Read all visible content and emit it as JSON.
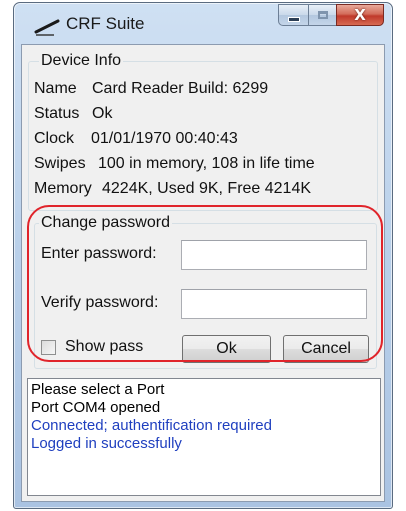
{
  "window": {
    "title": "CRF Suite",
    "controls": {
      "minimize": "minimize",
      "maximize": "maximize",
      "close_glyph": "X"
    }
  },
  "device_info": {
    "title": "Device Info",
    "rows": [
      {
        "key": "Name",
        "value": "Card Reader Build: 6299"
      },
      {
        "key": "Status",
        "value": "Ok"
      },
      {
        "key": "Clock",
        "value": "01/01/1970 00:40:43"
      },
      {
        "key": "Swipes",
        "value": "100 in memory, 108 in life time"
      },
      {
        "key": "Memory",
        "value": "4224K, Used 9K, Free 4214K"
      }
    ]
  },
  "change_password": {
    "title": "Change password",
    "enter_label": "Enter password:",
    "enter_value": "",
    "verify_label": "Verify password:",
    "verify_value": "",
    "show_pass_label": "Show pass",
    "show_pass_checked": false,
    "ok_label": "Ok",
    "cancel_label": "Cancel"
  },
  "log": {
    "lines": [
      {
        "text": "Please select a Port",
        "color": "#000000"
      },
      {
        "text": "Port COM4 opened",
        "color": "#000000"
      },
      {
        "text": "Connected; authentification required",
        "color": "#1f3fbf"
      },
      {
        "text": "Logged in successfully",
        "color": "#1f3fbf"
      }
    ]
  },
  "colors": {
    "highlight": "#e0242b",
    "log_info": "#1f3fbf"
  }
}
